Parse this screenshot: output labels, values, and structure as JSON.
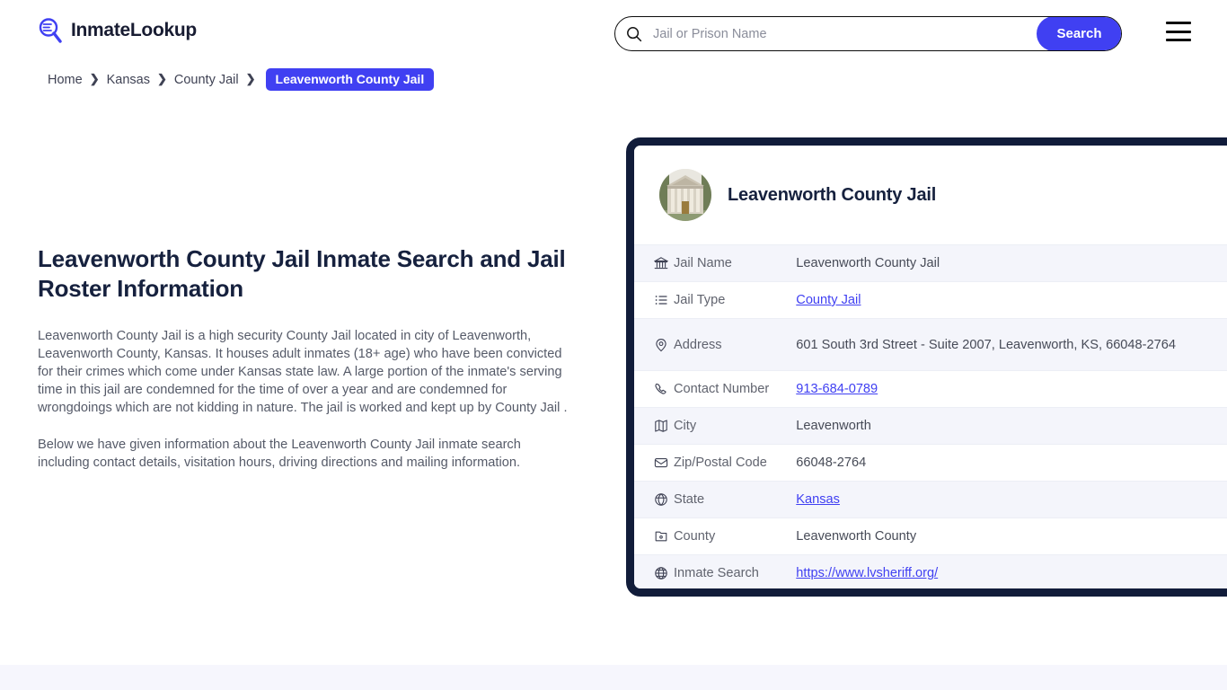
{
  "header": {
    "brand_name": "InmateLookup",
    "brand_icon": "magnifier-list-logo-icon",
    "search": {
      "placeholder": "Jail or Prison Name",
      "value": "",
      "icon": "search-icon",
      "button_label": "Search"
    },
    "menu_icon": "hamburger-menu-icon"
  },
  "breadcrumb": {
    "items": [
      {
        "label": "Home",
        "current": false
      },
      {
        "label": "Kansas",
        "current": false
      },
      {
        "label": "County Jail",
        "current": false
      },
      {
        "label": "Leavenworth County Jail",
        "current": true
      }
    ],
    "separator": "❯"
  },
  "main": {
    "title": "Leavenworth County Jail Inmate Search and Jail Roster Information",
    "paragraphs": [
      "Leavenworth County Jail is a high security County Jail located in city of Leavenworth, Leavenworth County, Kansas. It houses adult inmates (18+ age) who have been convicted for their crimes which come under Kansas state law. A large portion of the inmate's serving time in this jail are condemned for the time of over a year and are condemned for wrongdoings which are not kidding in nature. The jail is worked and kept up by County Jail .",
      "Below we have given information about the Leavenworth County Jail inmate search including contact details, visitation hours, driving directions and mailing information."
    ]
  },
  "card": {
    "avatar_icon": "courthouse-building-photo",
    "title": "Leavenworth County Jail",
    "rows": [
      {
        "icon": "bank-icon",
        "label": "Jail Name",
        "value": "Leavenworth County Jail",
        "link": false
      },
      {
        "icon": "list-icon",
        "label": "Jail Type",
        "value": "County Jail",
        "link": true
      },
      {
        "icon": "map-pin-icon",
        "label": "Address",
        "value": "601 South 3rd Street - Suite 2007, Leavenworth, KS, 66048-2764",
        "link": false
      },
      {
        "icon": "phone-icon",
        "label": "Contact Number",
        "value": "913-684-0789",
        "link": true
      },
      {
        "icon": "map-icon",
        "label": "City",
        "value": "Leavenworth",
        "link": false
      },
      {
        "icon": "envelope-icon",
        "label": "Zip/Postal Code",
        "value": "66048-2764",
        "link": false
      },
      {
        "icon": "globe-state-icon",
        "label": "State",
        "value": "Kansas",
        "link": true
      },
      {
        "icon": "county-icon",
        "label": "County",
        "value": "Leavenworth County",
        "link": false
      },
      {
        "icon": "globe-icon",
        "label": "Inmate Search",
        "value": "https://www.lvsheriff.org/",
        "link": true
      }
    ]
  },
  "colors": {
    "accent_blue": "#4040f2",
    "card_border_navy": "#111c3a",
    "heading_navy": "#16213e",
    "row_shade": "#f4f5fb",
    "footer_strip": "#f6f6fd"
  }
}
